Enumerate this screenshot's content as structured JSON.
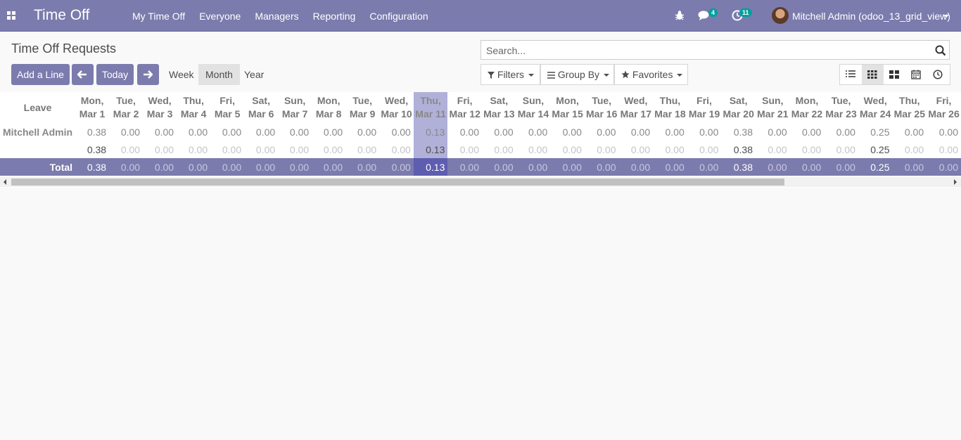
{
  "navbar": {
    "app_title": "Time Off",
    "menu": [
      "My Time Off",
      "Everyone",
      "Managers",
      "Reporting",
      "Configuration"
    ],
    "chat_count": "4",
    "activity_count": "11",
    "user_name": "Mitchell Admin (odoo_13_grid_view)"
  },
  "control_panel": {
    "title": "Time Off Requests",
    "add_line_label": "Add a Line",
    "today_label": "Today",
    "range_week": "Week",
    "range_month": "Month",
    "range_year": "Year",
    "active_range": "Month",
    "search_placeholder": "Search...",
    "filters_label": "Filters",
    "groupby_label": "Group By",
    "favorites_label": "Favorites",
    "active_view": "grid"
  },
  "grid": {
    "row_header": "Leave",
    "days": [
      {
        "dow": "Mon,",
        "date": "Mar 1"
      },
      {
        "dow": "Tue,",
        "date": "Mar 2"
      },
      {
        "dow": "Wed,",
        "date": "Mar 3"
      },
      {
        "dow": "Thu,",
        "date": "Mar 4"
      },
      {
        "dow": "Fri,",
        "date": "Mar 5"
      },
      {
        "dow": "Sat,",
        "date": "Mar 6"
      },
      {
        "dow": "Sun,",
        "date": "Mar 7"
      },
      {
        "dow": "Mon,",
        "date": "Mar 8"
      },
      {
        "dow": "Tue,",
        "date": "Mar 9"
      },
      {
        "dow": "Wed,",
        "date": "Mar 10"
      },
      {
        "dow": "Thu,",
        "date": "Mar 11"
      },
      {
        "dow": "Fri,",
        "date": "Mar 12"
      },
      {
        "dow": "Sat,",
        "date": "Mar 13"
      },
      {
        "dow": "Sun,",
        "date": "Mar 14"
      },
      {
        "dow": "Mon,",
        "date": "Mar 15"
      },
      {
        "dow": "Tue,",
        "date": "Mar 16"
      },
      {
        "dow": "Wed,",
        "date": "Mar 17"
      },
      {
        "dow": "Thu,",
        "date": "Mar 18"
      },
      {
        "dow": "Fri,",
        "date": "Mar 19"
      },
      {
        "dow": "Sat,",
        "date": "Mar 20"
      },
      {
        "dow": "Sun,",
        "date": "Mar 21"
      },
      {
        "dow": "Mon,",
        "date": "Mar 22"
      },
      {
        "dow": "Tue,",
        "date": "Mar 23"
      },
      {
        "dow": "Wed,",
        "date": "Mar 24"
      },
      {
        "dow": "Thu,",
        "date": "Mar 25"
      },
      {
        "dow": "Fri,",
        "date": "Mar 26"
      }
    ],
    "today_date": "Mar 11",
    "group_row": {
      "label": "Mitchell Admin",
      "values": [
        "0.38",
        "0.00",
        "0.00",
        "0.00",
        "0.00",
        "0.00",
        "0.00",
        "0.00",
        "0.00",
        "0.00",
        "0.13",
        "0.00",
        "0.00",
        "0.00",
        "0.00",
        "0.00",
        "0.00",
        "0.00",
        "0.00",
        "0.38",
        "0.00",
        "0.00",
        "0.00",
        "0.25",
        "0.00",
        "0.00"
      ]
    },
    "detail_row": {
      "label": "",
      "values": [
        "0.38",
        "0.00",
        "0.00",
        "0.00",
        "0.00",
        "0.00",
        "0.00",
        "0.00",
        "0.00",
        "0.00",
        "0.13",
        "0.00",
        "0.00",
        "0.00",
        "0.00",
        "0.00",
        "0.00",
        "0.00",
        "0.00",
        "0.38",
        "0.00",
        "0.00",
        "0.00",
        "0.25",
        "0.00",
        "0.00"
      ]
    },
    "total_row": {
      "label": "Total",
      "values": [
        "0.38",
        "0.00",
        "0.00",
        "0.00",
        "0.00",
        "0.00",
        "0.00",
        "0.00",
        "0.00",
        "0.00",
        "0.13",
        "0.00",
        "0.00",
        "0.00",
        "0.00",
        "0.00",
        "0.00",
        "0.00",
        "0.00",
        "0.38",
        "0.00",
        "0.00",
        "0.00",
        "0.25",
        "0.00",
        "0.00"
      ]
    }
  }
}
